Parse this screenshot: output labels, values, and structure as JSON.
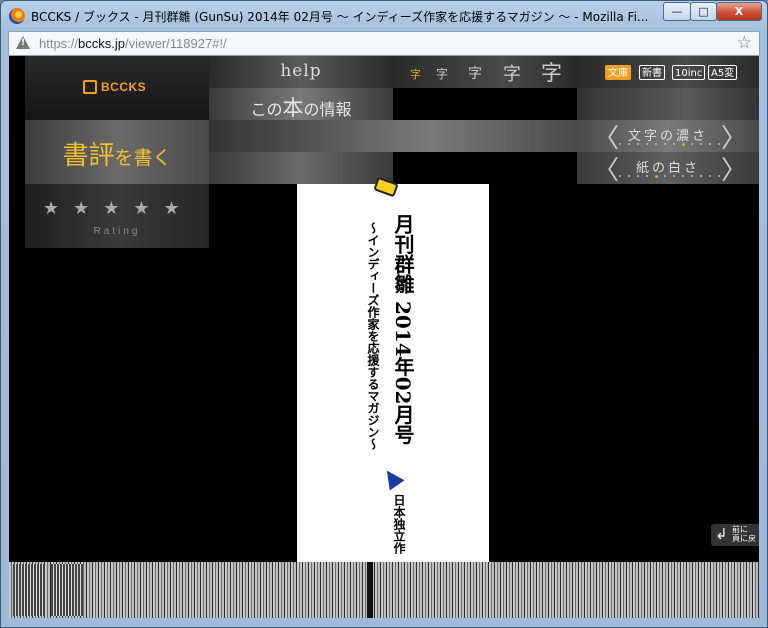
{
  "window": {
    "title": "BCCKS / ブックス - 月刊群雛 (GunSu) 2014年 02月号 ～ インディーズ作家を応援するマガジン ～ - Mozilla Fi...",
    "minimize": "—",
    "maximize": "□",
    "close": "X"
  },
  "urlbar": {
    "scheme": "https://",
    "host": "bccks.jp",
    "path": "/viewer/118927#!/"
  },
  "menu": {
    "logo": "BCCKS",
    "help": "help",
    "info_prefix": "この",
    "info_big": "本",
    "info_suffix": "の情報",
    "review_main": "書評",
    "review_small": "を書く",
    "font_sizes": [
      "字",
      "字",
      "字",
      "字",
      "字"
    ],
    "formats": [
      "文庫",
      "新書",
      "10inc",
      "A5変"
    ],
    "density_label": "文字の濃さ",
    "whiteness_label": "紙の白さ",
    "density_level": 0.6,
    "whiteness_level": 0.35,
    "stars": "★★★★★",
    "rating_label": "Rating",
    "chev_left": "〈",
    "chev_right": "〉"
  },
  "page": {
    "title": "月刊群雛 2014年02月号",
    "subtitle": "～インディーズ作家を応援するマガジン～",
    "publisher": "日本独立作"
  },
  "prev_button": {
    "arrow": "↲",
    "line1": "前に",
    "line2": "頁に戻"
  }
}
